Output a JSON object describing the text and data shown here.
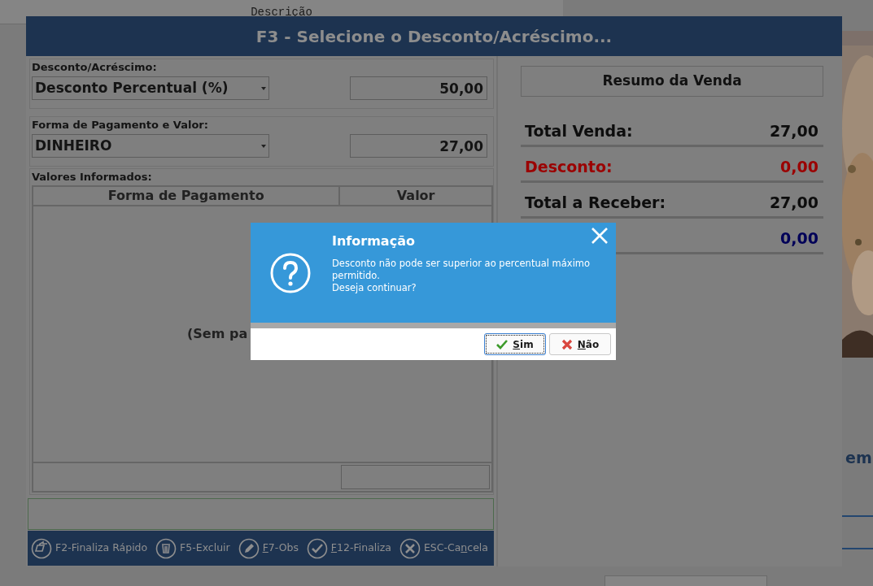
{
  "background": {
    "column_header": "Descrição",
    "side_text": "em"
  },
  "dialog": {
    "title": "F3 - Selecione o Desconto/Acréscimo...",
    "discount_section": {
      "label": "Desconto/Acréscimo:",
      "type": "Desconto Percentual (%)",
      "value": "50,00"
    },
    "payment_section": {
      "label": "Forma de Pagamento e Valor:",
      "method": "DINHEIRO",
      "value": "27,00"
    },
    "entries": {
      "label": "Valores Informados:",
      "columns": [
        "Forma de Pagamento",
        "Valor"
      ],
      "empty_text": "(Sem pa"
    },
    "toolbar": [
      {
        "kind": "quick",
        "label_before": "F2-Finaliza Rápido"
      },
      {
        "kind": "delete",
        "label_before": "F5-Excluir"
      },
      {
        "kind": "note",
        "access_key": "F",
        "label_after": "7-Obs"
      },
      {
        "kind": "finish",
        "access_key": "F",
        "label_after": "12-Finaliza"
      },
      {
        "kind": "cancel",
        "label_before": "ESC-Ca",
        "access_key": "n",
        "label_after": "cela"
      }
    ],
    "summary": {
      "title": "Resumo da Venda",
      "rows": [
        {
          "kind": "normal",
          "label": "Total Venda:",
          "value": "27,00"
        },
        {
          "kind": "discount",
          "label": "Desconto:",
          "value": "0,00"
        },
        {
          "kind": "normal",
          "label": "Total a Receber:",
          "value": "27,00"
        },
        {
          "kind": "change",
          "value": "0,00"
        }
      ]
    }
  },
  "message": {
    "title": "Informação",
    "lines": [
      "Desconto não pode ser superior ao percentual máximo permitido.",
      "Deseja continuar?"
    ],
    "buttons": [
      {
        "kind": "yes",
        "access_key": "S",
        "label_after": "im",
        "focused": true
      },
      {
        "kind": "no",
        "access_key": "N",
        "label_after": "ão",
        "focused": false
      }
    ]
  }
}
